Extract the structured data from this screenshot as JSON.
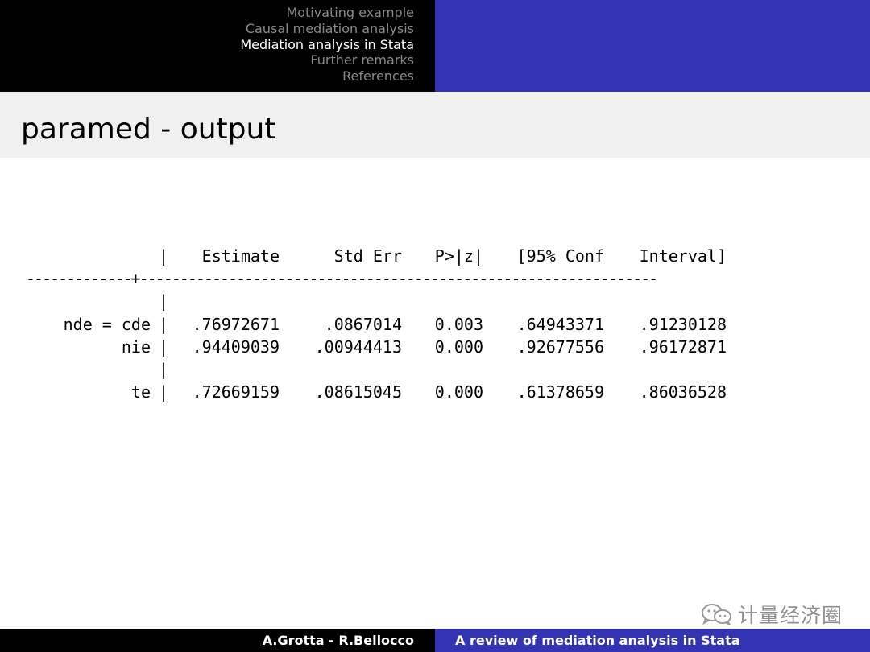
{
  "header": {
    "nav": [
      {
        "label": "Motivating example",
        "active": false
      },
      {
        "label": "Causal mediation analysis",
        "active": false
      },
      {
        "label": "Mediation analysis in Stata",
        "active": true
      },
      {
        "label": "Further remarks",
        "active": false
      },
      {
        "label": "References",
        "active": false
      }
    ]
  },
  "frame": {
    "title": "paramed - output"
  },
  "output": {
    "separator": "|",
    "columns": [
      "Estimate",
      "Std Err",
      "P>|z|",
      "[95% Conf",
      "Interval]"
    ],
    "divider_left": "-------------+",
    "divider_right": "----------------------------------------------------------------",
    "rows": [
      {
        "label": "nde = cde",
        "estimate": ".76972671",
        "std_err": ".0867014",
        "p": "0.003",
        "ci_low": ".64943371",
        "ci_high": ".91230128"
      },
      {
        "label": "nie",
        "estimate": ".94409039",
        "std_err": ".00944413",
        "p": "0.000",
        "ci_low": ".92677556",
        "ci_high": ".96172871"
      },
      {
        "label": "te",
        "estimate": ".72669159",
        "std_err": ".08615045",
        "p": "0.000",
        "ci_low": ".61378659",
        "ci_high": ".86036528"
      }
    ]
  },
  "watermark": {
    "text": "计量经济圈"
  },
  "footer": {
    "authors": "A.Grotta - R.Bellocco",
    "talk_title": "A review of mediation analysis in Stata"
  },
  "colors": {
    "header_left": "#000000",
    "header_right": "#3333b3",
    "title_band": "#f0f0f0",
    "nav_inactive": "#8a8a8a",
    "nav_active": "#ffffff"
  }
}
